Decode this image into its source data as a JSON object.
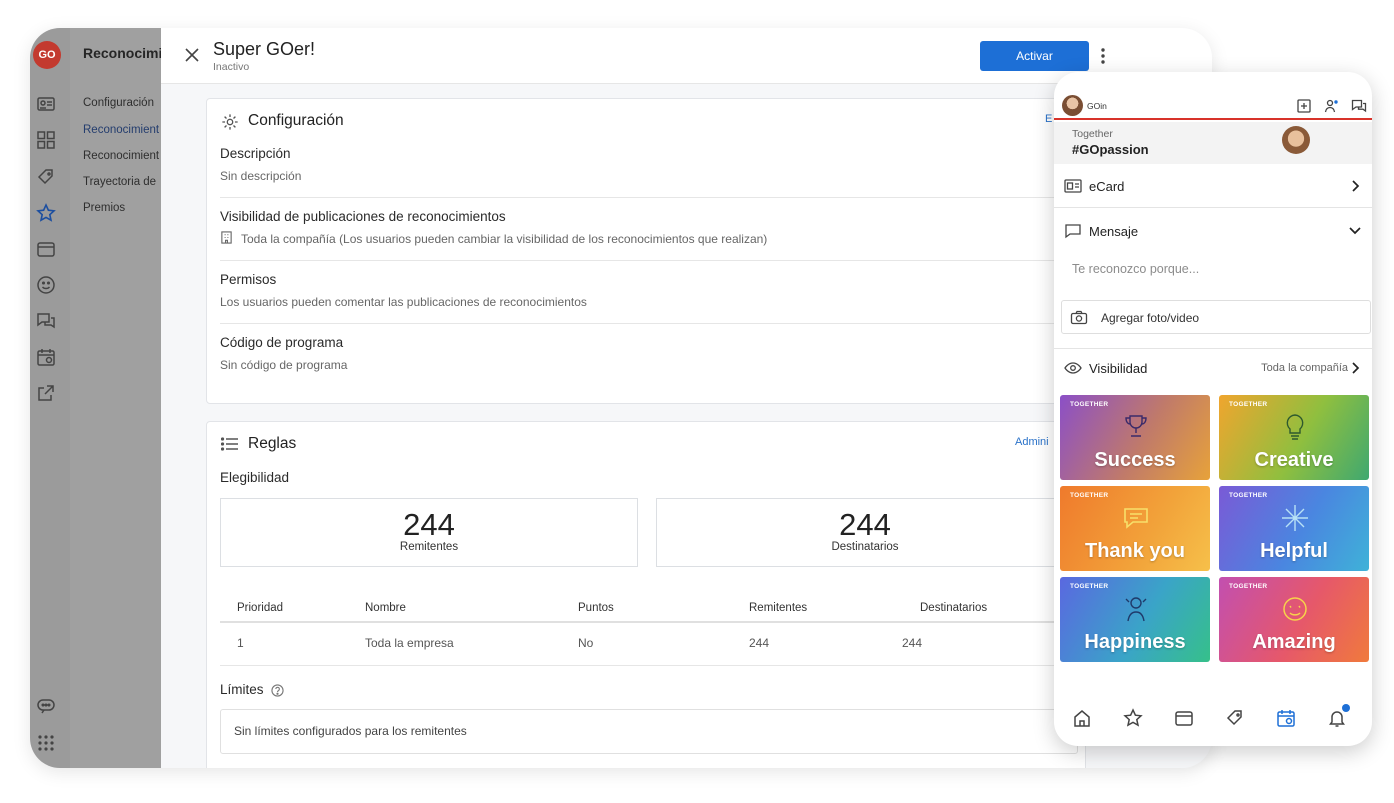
{
  "sidebar": {
    "logo_text": "GO",
    "title": "Reconocimie",
    "items": [
      {
        "label": "Configuración"
      },
      {
        "label": "Reconocimient"
      },
      {
        "label": "Reconocimient"
      },
      {
        "label": "Trayectoria de"
      },
      {
        "label": "Premios"
      }
    ],
    "rail_icons": [
      "id-card-icon",
      "grid-icon",
      "tag-icon",
      "star-icon",
      "wallet-icon",
      "smile-icon",
      "chat-icon",
      "calendar-icon",
      "external-link-icon"
    ],
    "bottom_icons": [
      "feedback-icon",
      "apps-grid-icon"
    ]
  },
  "header": {
    "title": "Super GOer!",
    "status": "Inactivo",
    "activate_label": "Activar"
  },
  "config": {
    "title": "Configuración",
    "edit_link": "E",
    "description_label": "Descripción",
    "description_value": "Sin descripción",
    "visibility_label": "Visibilidad de publicaciones de reconocimientos",
    "visibility_value": "Toda la compañía (Los usuarios pueden cambiar la visibilidad de los reconocimientos que realizan)",
    "permissions_label": "Permisos",
    "permissions_value": "Los usuarios pueden comentar las publicaciones de reconocimientos",
    "code_label": "Código de programa",
    "code_value": "Sin código de programa"
  },
  "rules": {
    "title": "Reglas",
    "admin_link": "Admini",
    "eligibility_label": "Elegibilidad",
    "senders_count": "244",
    "senders_label": "Remitentes",
    "recipients_count": "244",
    "recipients_label": "Destinatarios",
    "table_headers": [
      "Prioridad",
      "Nombre",
      "Puntos",
      "Remitentes",
      "Destinatarios"
    ],
    "table_rows": [
      [
        "1",
        "Toda la empresa",
        "No",
        "244",
        "244"
      ]
    ],
    "limits_label": "Límites",
    "limits_value": "Sin límites configurados para los remitentes"
  },
  "phone": {
    "user": "GOin",
    "banner_small": "Together",
    "banner_tag": "#GOpassion",
    "ecard_label": "eCard",
    "message_label": "Mensaje",
    "message_placeholder": "Te reconozco porque...",
    "photo_label": "Agregar foto/video",
    "visibility_label": "Visibilidad",
    "visibility_value": "Toda la compañía",
    "tiles": [
      {
        "tag": "TOGETHER",
        "word": "Success"
      },
      {
        "tag": "TOGETHER",
        "word": "Creative"
      },
      {
        "tag": "TOGETHER",
        "word": "Thank you"
      },
      {
        "tag": "TOGETHER",
        "word": "Helpful"
      },
      {
        "tag": "TOGETHER",
        "word": "Happiness"
      },
      {
        "tag": "TOGETHER",
        "word": "Amazing"
      }
    ],
    "tab_icons": [
      "home-icon",
      "star-icon",
      "wallet-icon",
      "tag-icon",
      "calendar-icon",
      "bell-icon"
    ],
    "accent": "#1d6fd6",
    "divider_color": "#d8332a"
  }
}
